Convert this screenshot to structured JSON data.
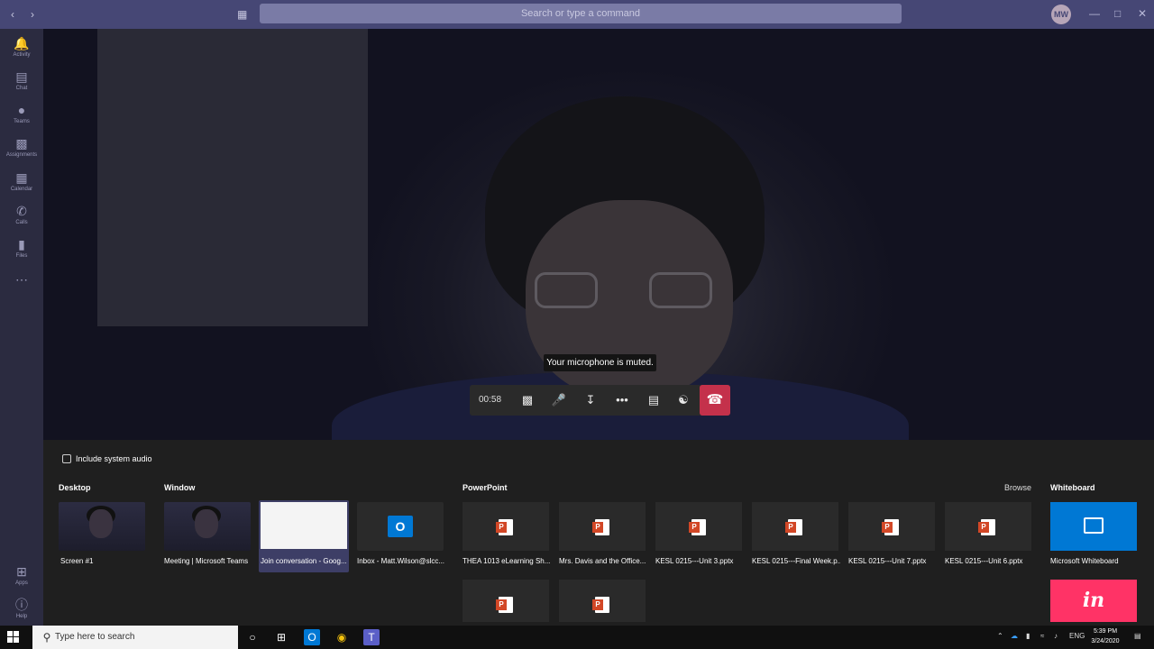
{
  "search": {
    "placeholder": "Search or type a command"
  },
  "user": {
    "initials": "MW"
  },
  "rail": [
    {
      "label": "Activity",
      "icon": "bell-icon"
    },
    {
      "label": "Chat",
      "icon": "chat-icon"
    },
    {
      "label": "Teams",
      "icon": "teams-icon"
    },
    {
      "label": "Assignments",
      "icon": "assignments-icon"
    },
    {
      "label": "Calendar",
      "icon": "calendar-icon"
    },
    {
      "label": "Calls",
      "icon": "phone-icon"
    },
    {
      "label": "Files",
      "icon": "files-icon"
    },
    {
      "label": "Apps",
      "icon": "apps-icon"
    },
    {
      "label": "Help",
      "icon": "help-icon"
    }
  ],
  "call": {
    "timer": "00:58",
    "mute_toast": "Your microphone is muted."
  },
  "share": {
    "include_audio_label": "Include system audio",
    "sections": {
      "desktop": "Desktop",
      "window": "Window",
      "powerpoint": "PowerPoint",
      "browse": "Browse",
      "whiteboard": "Whiteboard"
    },
    "desktop_items": [
      {
        "caption": "Screen #1"
      }
    ],
    "window_items": [
      {
        "caption": "Meeting | Microsoft Teams"
      },
      {
        "caption": "Join conversation - Goog..."
      },
      {
        "caption": "Inbox - Matt.Wilson@slcc..."
      }
    ],
    "powerpoint_items": [
      {
        "caption": "THEA 1013 eLearning Sh..."
      },
      {
        "caption": "Mrs. Davis and the Office..."
      },
      {
        "caption": "KESL 0215---Unit 3.pptx"
      },
      {
        "caption": "KESL 0215---Final Week.p..."
      },
      {
        "caption": "KESL 0215---Unit 7.pptx"
      },
      {
        "caption": "KESL 0215---Unit 6.pptx"
      }
    ],
    "whiteboard_items": [
      {
        "caption": "Microsoft Whiteboard"
      }
    ]
  },
  "taskbar": {
    "search_placeholder": "Type here to search",
    "lang": "ENG",
    "time": "5:39 PM",
    "date": "3/24/2020"
  },
  "colors": {
    "teams_purple": "#464775",
    "hangup_red": "#c4314b",
    "whiteboard_blue": "#0078d4",
    "invision_pink": "#ff3366"
  }
}
